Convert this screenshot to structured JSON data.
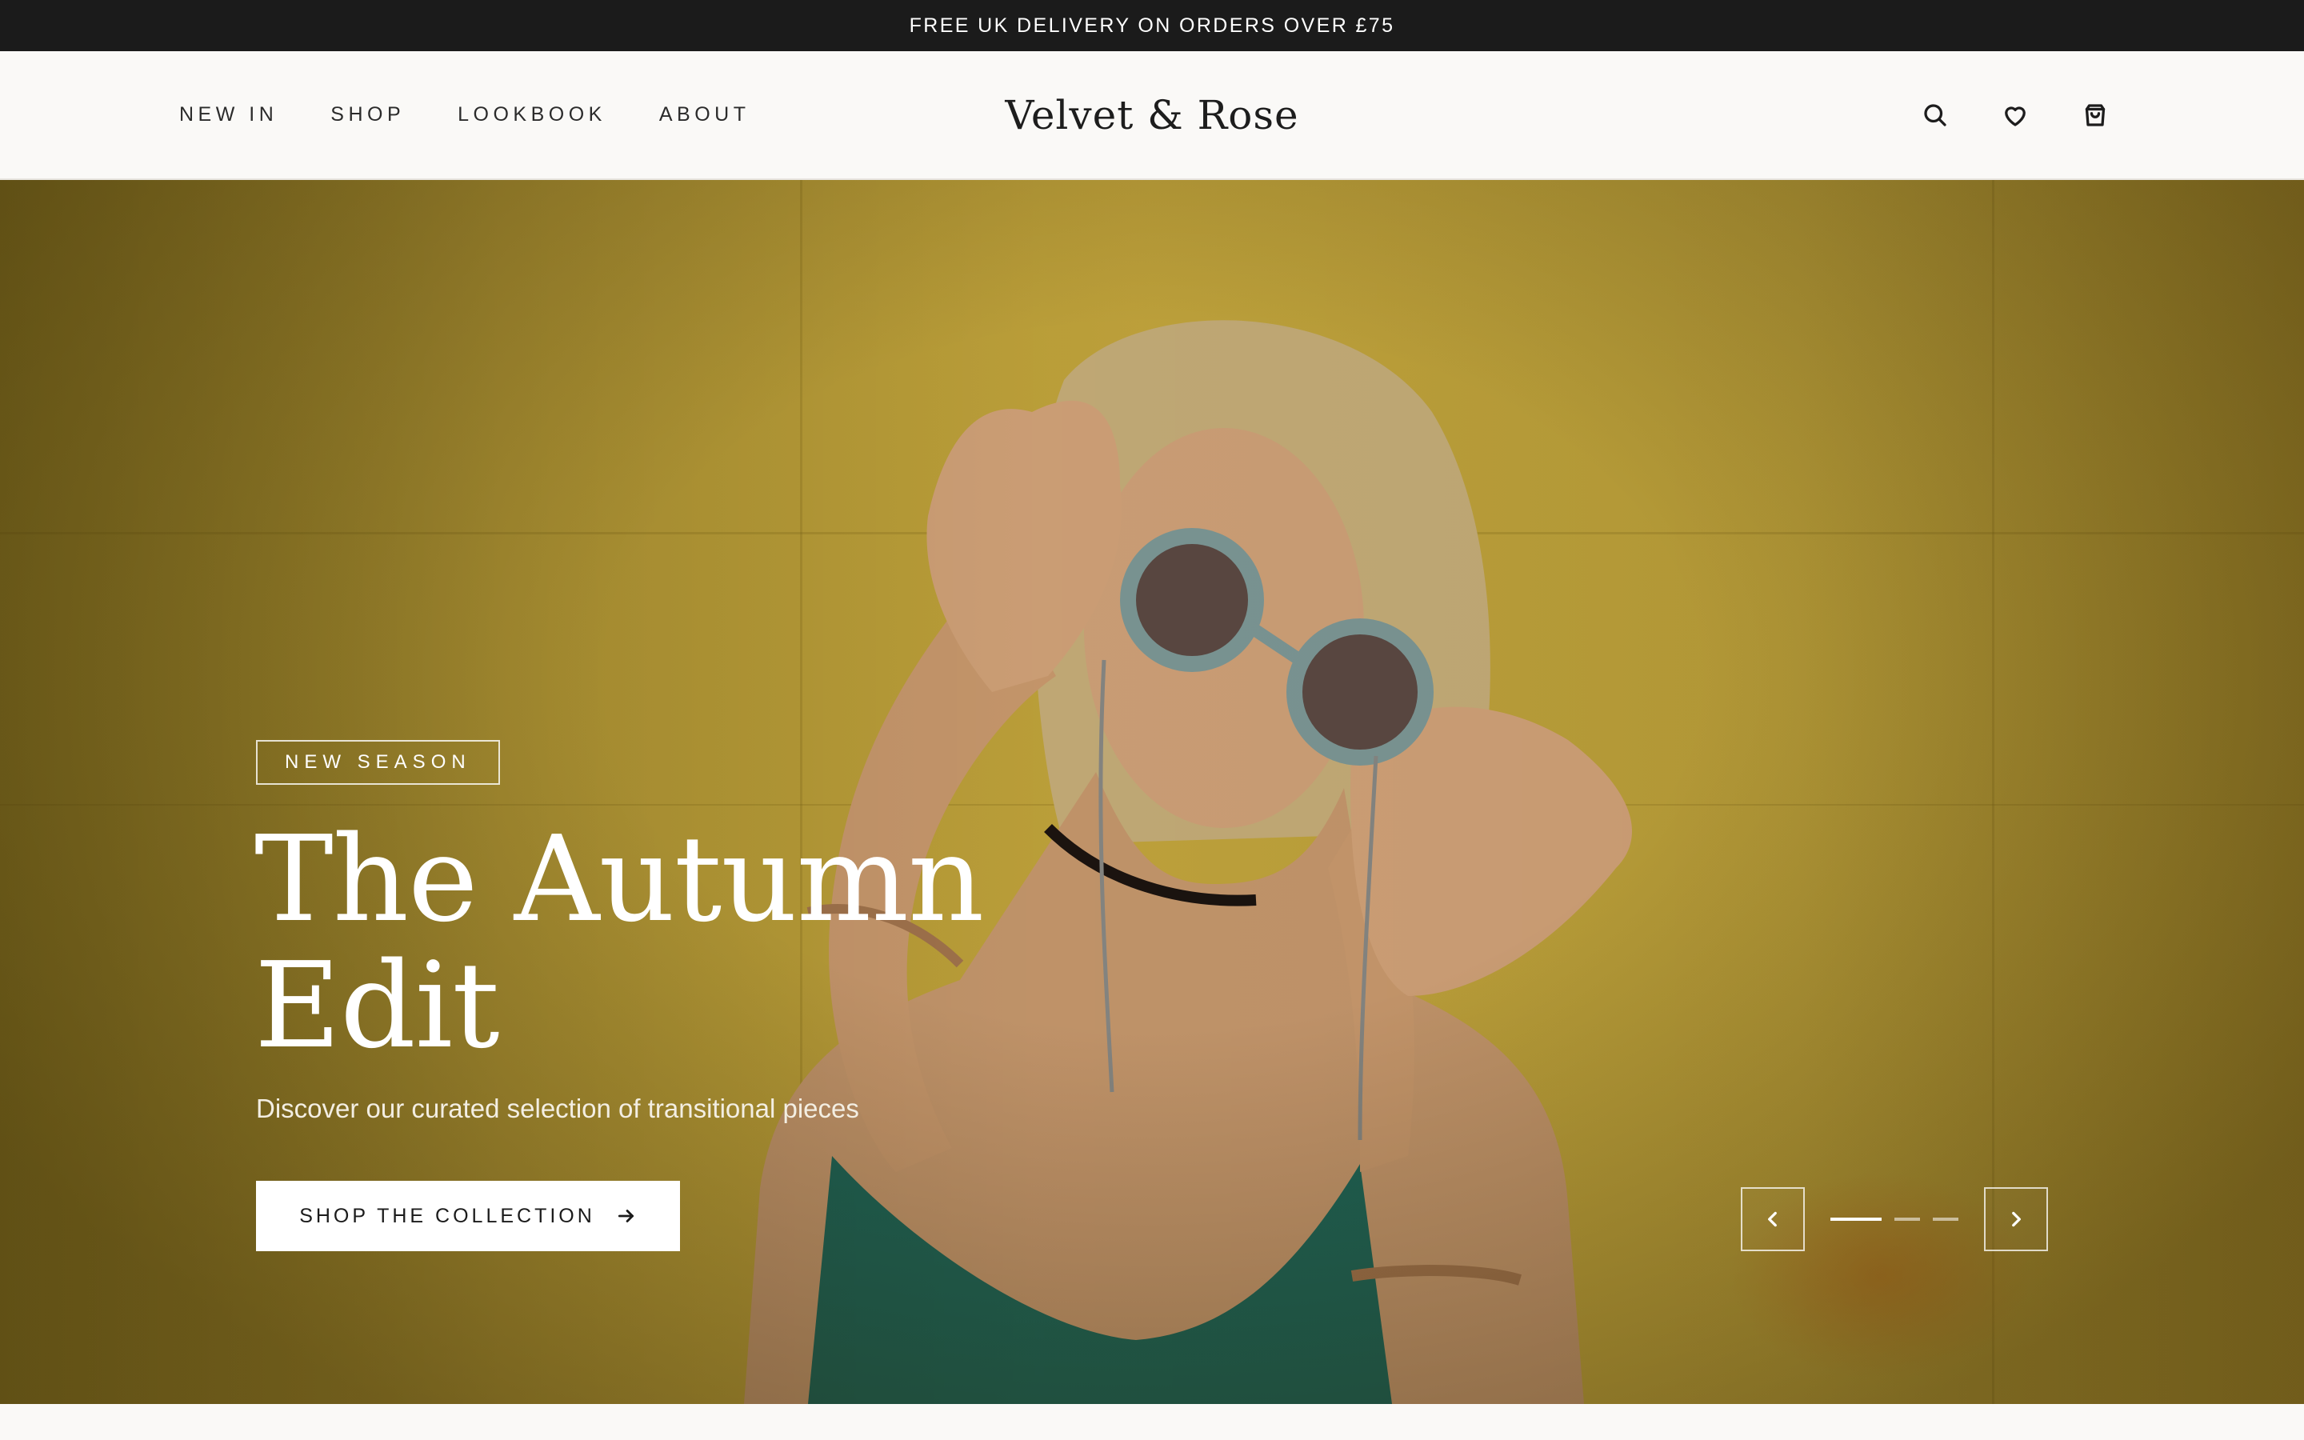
{
  "announcement": {
    "text": "FREE UK DELIVERY ON ORDERS OVER £75"
  },
  "header": {
    "nav": [
      {
        "label": "NEW IN"
      },
      {
        "label": "SHOP"
      },
      {
        "label": "LOOKBOOK"
      },
      {
        "label": "ABOUT"
      }
    ],
    "logo": "Velvet & Rose",
    "icons": [
      "search-icon",
      "heart-icon",
      "shopping-bag-icon"
    ]
  },
  "hero": {
    "badge": "NEW SEASON",
    "title_line1": "The Autumn",
    "title_line2": "Edit",
    "subtitle": "Discover our curated selection of transitional pieces",
    "cta_label": "SHOP THE COLLECTION",
    "cta_icon": "arrow-right-icon",
    "slides": {
      "count": 3,
      "active": 1
    },
    "prev_icon": "chevron-left-icon",
    "next_icon": "chevron-right-icon"
  },
  "colors": {
    "announcement_bg": "#1b1b1b",
    "header_bg": "#faf9f7",
    "hero_wall": "#c6a83d",
    "text_dark": "#1d1d1d"
  }
}
